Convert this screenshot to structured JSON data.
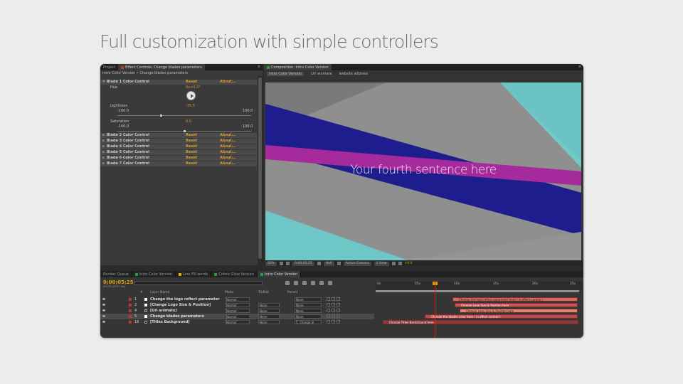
{
  "headline": "Full customization with simple controllers",
  "effect_panel": {
    "tabs": [
      "Project",
      "Effect Controls: Change blades parameters"
    ],
    "breadcrumb": "Intro Color Version • Change blades parameters",
    "rows": [
      {
        "name": "Blade 1 Color Control",
        "reset": "Reset",
        "about": "About...",
        "type": "head"
      },
      {
        "name": "Hue",
        "value": "0x+0.0°",
        "type": "prop"
      },
      {
        "name": "Lightness",
        "value": "-35.5",
        "min": "-100.0",
        "max": "100.0",
        "type": "prop"
      },
      {
        "name": "Saturation",
        "value": "0.0",
        "min": "-100.0",
        "max": "100.0",
        "type": "prop"
      },
      {
        "name": "Blade 2 Color Control",
        "reset": "Reset",
        "about": "About...",
        "type": "head"
      },
      {
        "name": "Blade 3 Color Control",
        "reset": "Reset",
        "about": "About...",
        "type": "head"
      },
      {
        "name": "Blade 4 Color Control",
        "reset": "Reset",
        "about": "About...",
        "type": "head"
      },
      {
        "name": "Blade 5 Color Control",
        "reset": "Reset",
        "about": "About...",
        "type": "head"
      },
      {
        "name": "Blade 6 Color Control",
        "reset": "Reset",
        "about": "About...",
        "type": "head"
      },
      {
        "name": "Blade 7 Color Control",
        "reset": "Reset",
        "about": "About...",
        "type": "head"
      }
    ]
  },
  "composition": {
    "tab": "Composition: Intro Color Version",
    "subtabs": [
      "Intro Color Version",
      "Url animate",
      "website address"
    ],
    "caption": "Your fourth sentence here",
    "toolbar": {
      "zoom": "50%",
      "timecode": "0;00;05;25",
      "resolution": "Half",
      "camera": "Active Camera",
      "view": "1 View",
      "exposure": "+0.0"
    },
    "colors": {
      "navy": "#1d1d8e",
      "magenta": "#a22a9a",
      "teal": "#6fc6c6",
      "gray": "#8a8a8a"
    }
  },
  "timeline": {
    "tabs": [
      "Render Queue",
      "Intro Color Version",
      "Line Fill words",
      "Colors Glow Version",
      "Intro Color Version"
    ],
    "timecode": "0;00;05;25",
    "timecode_sub": "00175 (29.97 fps)",
    "columns": {
      "num": "#",
      "layer_name": "Layer Name",
      "mode": "Mode",
      "trkmat": "TrkMat",
      "parent": "Parent"
    },
    "ruler_ticks": [
      "0s",
      "05s",
      "10s",
      "15s",
      "20s",
      "25s"
    ],
    "layers": [
      {
        "num": "1",
        "name": "Change the logo reflect parameter",
        "mode": "Normal",
        "trkmat": "",
        "parent": "None",
        "label": "#c0392b",
        "bar": "Change the logo reflect parameter here ( in effect control )"
      },
      {
        "num": "2",
        "name": "[Change Logo Size & Position]",
        "mode": "Normal",
        "trkmat": "None",
        "parent": "None",
        "label": "#c0392b",
        "bar": "Change Logo Size & Position here"
      },
      {
        "num": "4",
        "name": "[Url animate]",
        "mode": "Normal",
        "trkmat": "None",
        "parent": "None",
        "label": "#c0392b",
        "bar": "Change Logo Size & Position here"
      },
      {
        "num": "5",
        "name": "Change blades parameters",
        "mode": "Normal",
        "trkmat": "None",
        "parent": "None",
        "label": "#c0392b",
        "bar": "Change the blades color here ( in effect control )"
      },
      {
        "num": "16",
        "name": "[Titles Background]",
        "mode": "Normal",
        "trkmat": "None",
        "parent": "5. Change bl",
        "label": "#c0392b",
        "bar": "Change Titles Background here"
      }
    ]
  }
}
